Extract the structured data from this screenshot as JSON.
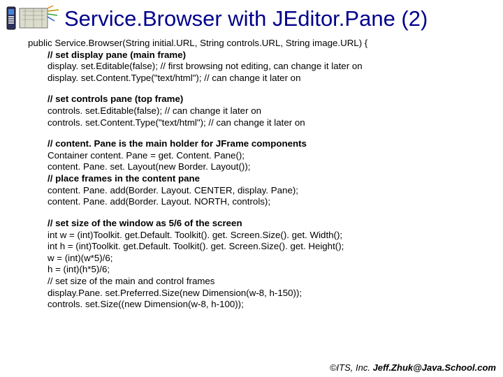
{
  "title": "Service.Browser with JEditor.Pane (2)",
  "code": {
    "sig": "public Service.Browser(String initial.URL, String controls.URL, String image.URL) {",
    "c1": "// set display pane (main frame)",
    "l1": "display. set.Editable(false); // first browsing not editing, can change it later on",
    "l2": "display. set.Content.Type(\"text/html\"); // can change it later on",
    "c2": "// set controls pane (top frame)",
    "l3": "controls. set.Editable(false); // can change it later on",
    "l4": "controls. set.Content.Type(\"text/html\"); // can change it later on",
    "c3": "// content. Pane is the main holder for JFrame components",
    "l5": "Container content. Pane = get. Content. Pane();",
    "l6": "content. Pane. set. Layout(new Border. Layout());",
    "c4": "// place frames in the content pane",
    "l7": "content. Pane. add(Border. Layout. CENTER, display. Pane);",
    "l8": "content. Pane. add(Border. Layout. NORTH, controls);",
    "c5": "// set size of the window as 5/6 of the screen",
    "l9": "int w = (int)Toolkit. get.Default. Toolkit(). get. Screen.Size(). get. Width();",
    "l10": "int h = (int)Toolkit. get.Default. Toolkit(). get. Screen.Size(). get. Height();",
    "l11": "w = (int)(w*5)/6;",
    "l12": "h = (int)(h*5)/6;",
    "l13": "// set size of the main and control frames",
    "l14": "display.Pane. set.Preferred.Size(new Dimension(w-8, h-150));",
    "l15": "controls. set.Size((new Dimension(w-8, h-100));"
  },
  "footer": {
    "copy": "©ITS, Inc. ",
    "mail": "Jeff.Zhuk@Java.School.com"
  }
}
